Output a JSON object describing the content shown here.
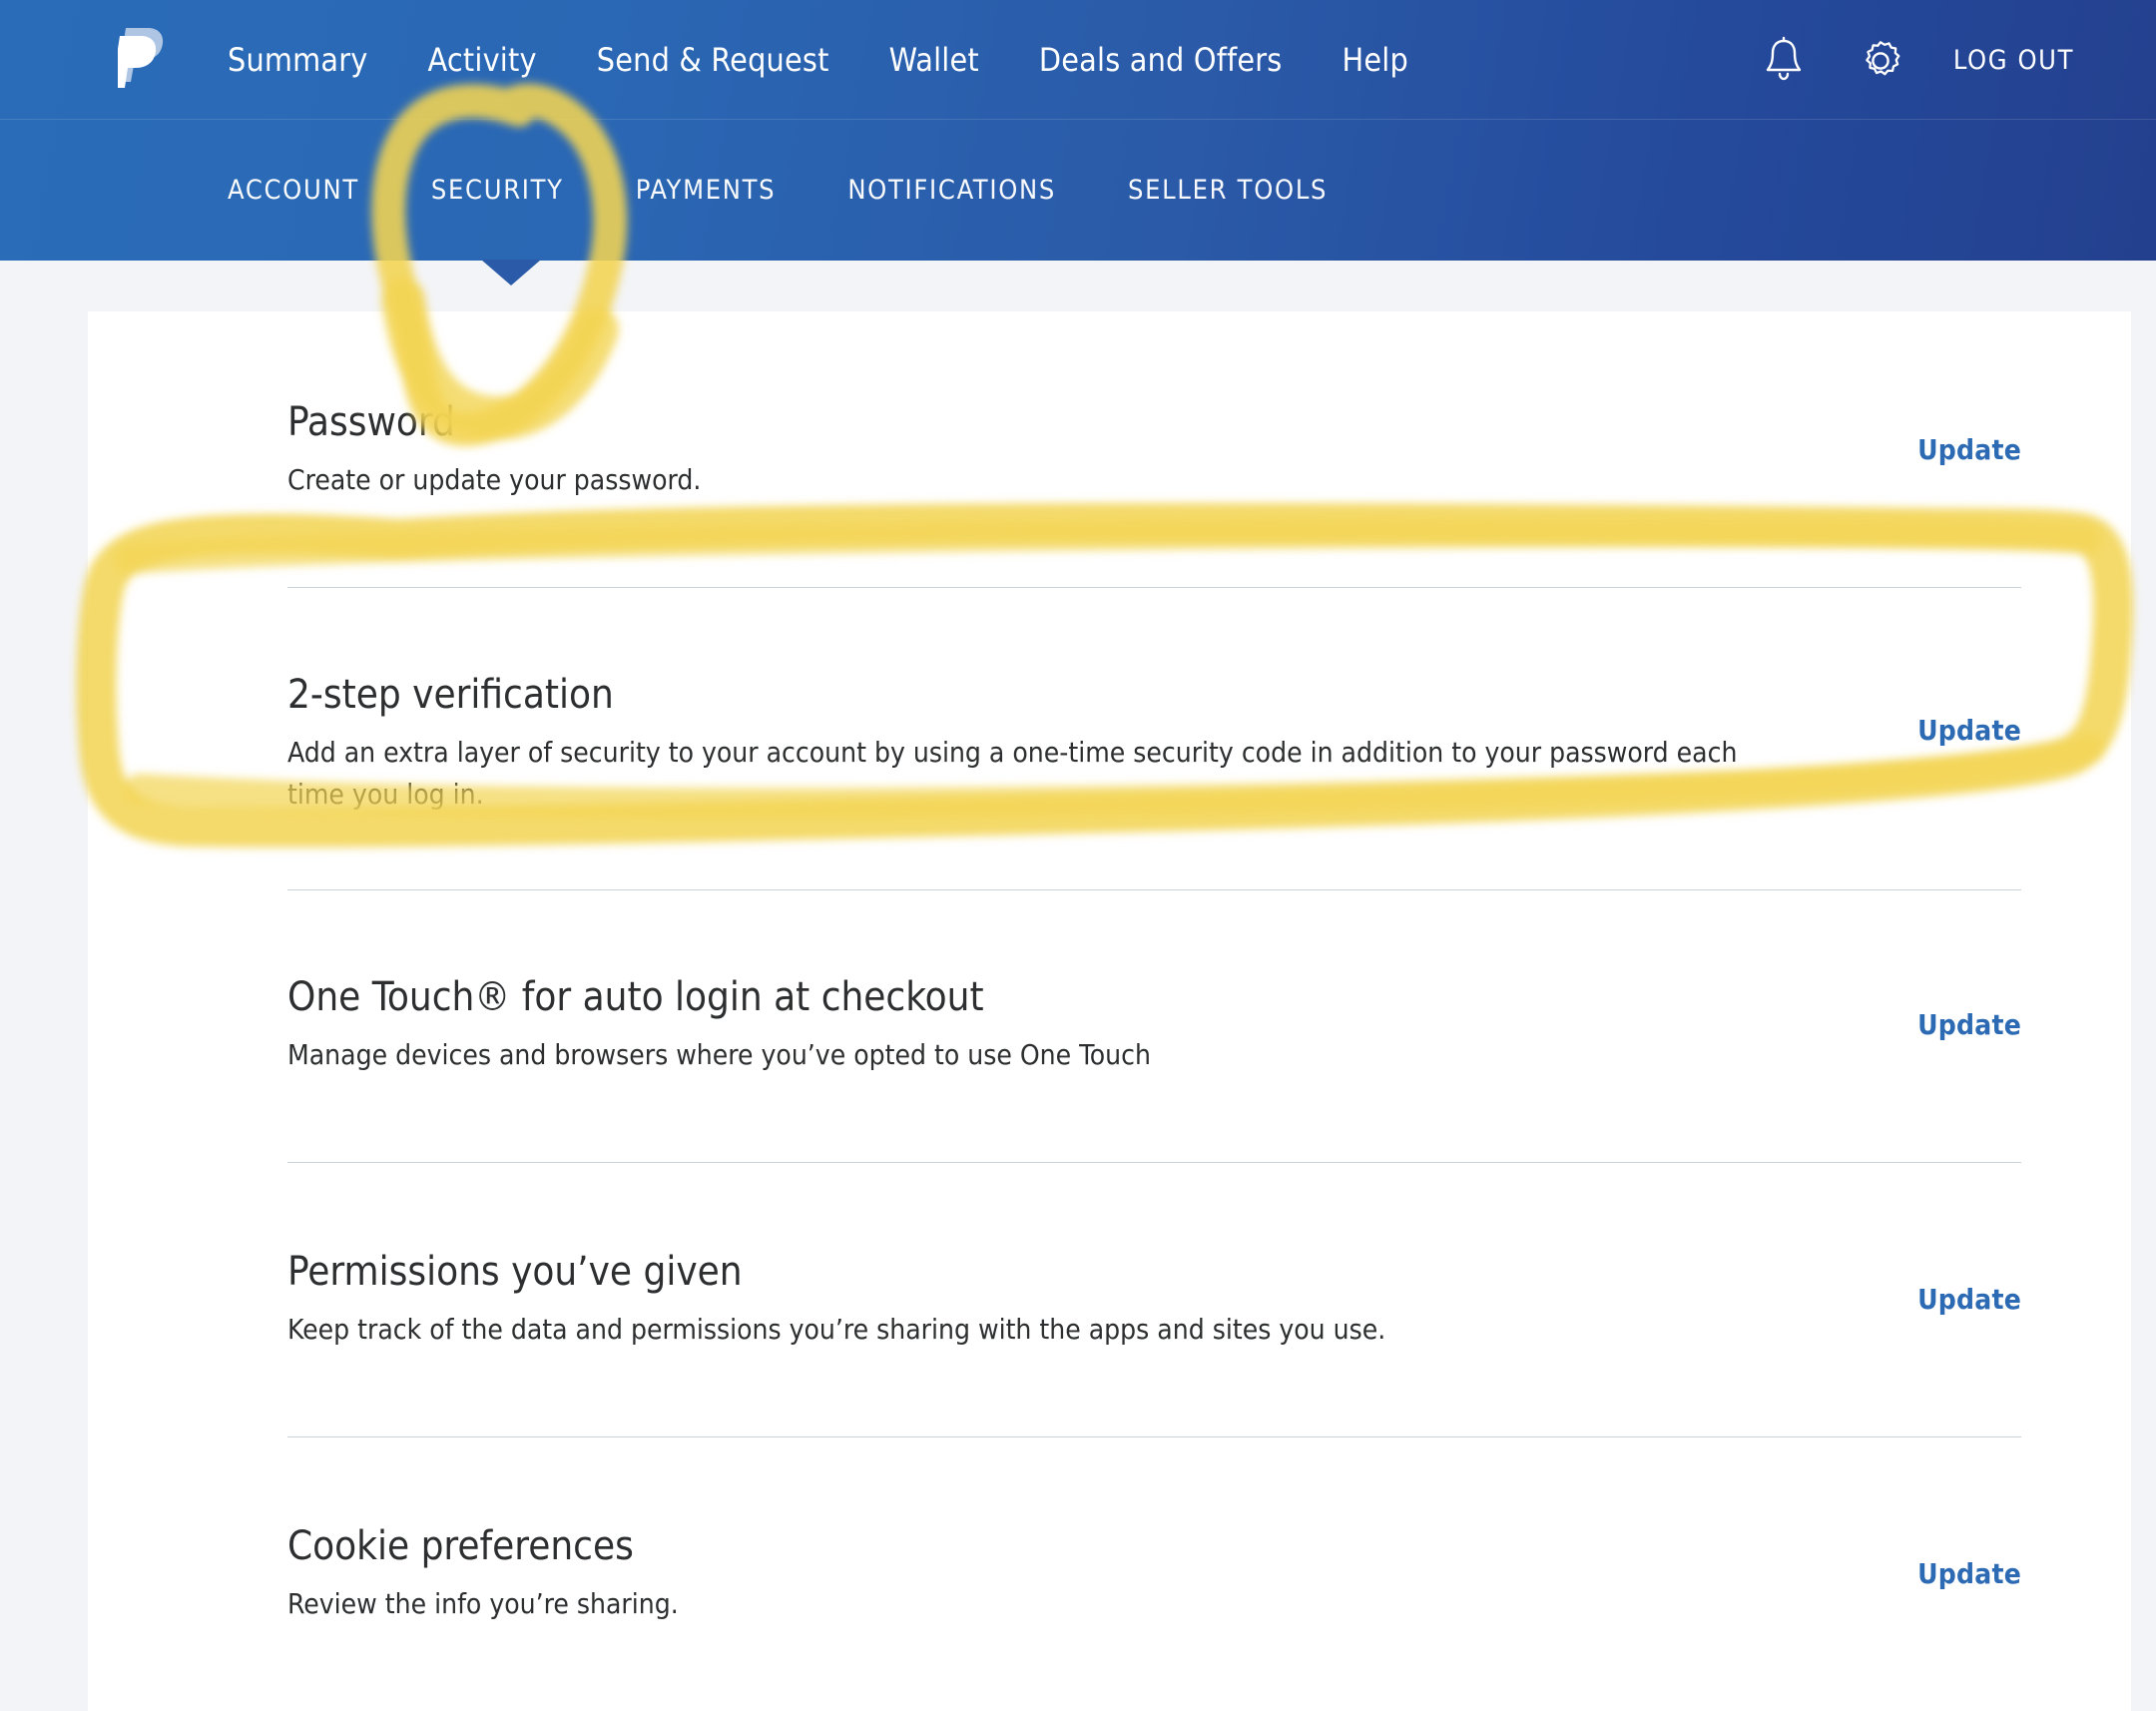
{
  "header": {
    "logo_name": "paypal-logo",
    "primary_nav": [
      {
        "label": "Summary"
      },
      {
        "label": "Activity"
      },
      {
        "label": "Send & Request"
      },
      {
        "label": "Wallet"
      },
      {
        "label": "Deals and Offers"
      },
      {
        "label": "Help"
      }
    ],
    "bell_icon": "bell-icon",
    "gear_icon": "gear-icon",
    "logout_label": "LOG OUT",
    "secondary_nav": [
      {
        "label": "ACCOUNT",
        "active": false
      },
      {
        "label": "SECURITY",
        "active": true
      },
      {
        "label": "PAYMENTS",
        "active": false
      },
      {
        "label": "NOTIFICATIONS",
        "active": false
      },
      {
        "label": "SELLER TOOLS",
        "active": false
      }
    ]
  },
  "settings": {
    "sections": [
      {
        "title": "Password",
        "description": "Create or update your password.",
        "action": "Update"
      },
      {
        "title": "2-step verification",
        "description": "Add an extra layer of security to your account by using a one-time security code in addition to your password each time you log in.",
        "action": "Update"
      },
      {
        "title": "One Touch® for auto login at checkout",
        "description": "Manage devices and browsers where you’ve opted to use One Touch",
        "action": "Update"
      },
      {
        "title": "Permissions you’ve given",
        "description": "Keep track of the data and permissions you’re sharing with the apps and sites you use.",
        "action": "Update"
      },
      {
        "title": "Cookie preferences",
        "description": "Review the info you’re sharing.",
        "action": "Update"
      }
    ]
  },
  "annotations": {
    "highlighter_color": "#f2d452",
    "circle_target": "SECURITY",
    "box_target": "2-step verification"
  },
  "colors": {
    "header_left": "#2a6cb8",
    "header_right": "#23408e",
    "page_background": "#f3f4f8",
    "card_background": "#ffffff",
    "link_blue": "#2c6ab4",
    "text": "#2c2e2f",
    "divider": "#cbd2d6"
  }
}
